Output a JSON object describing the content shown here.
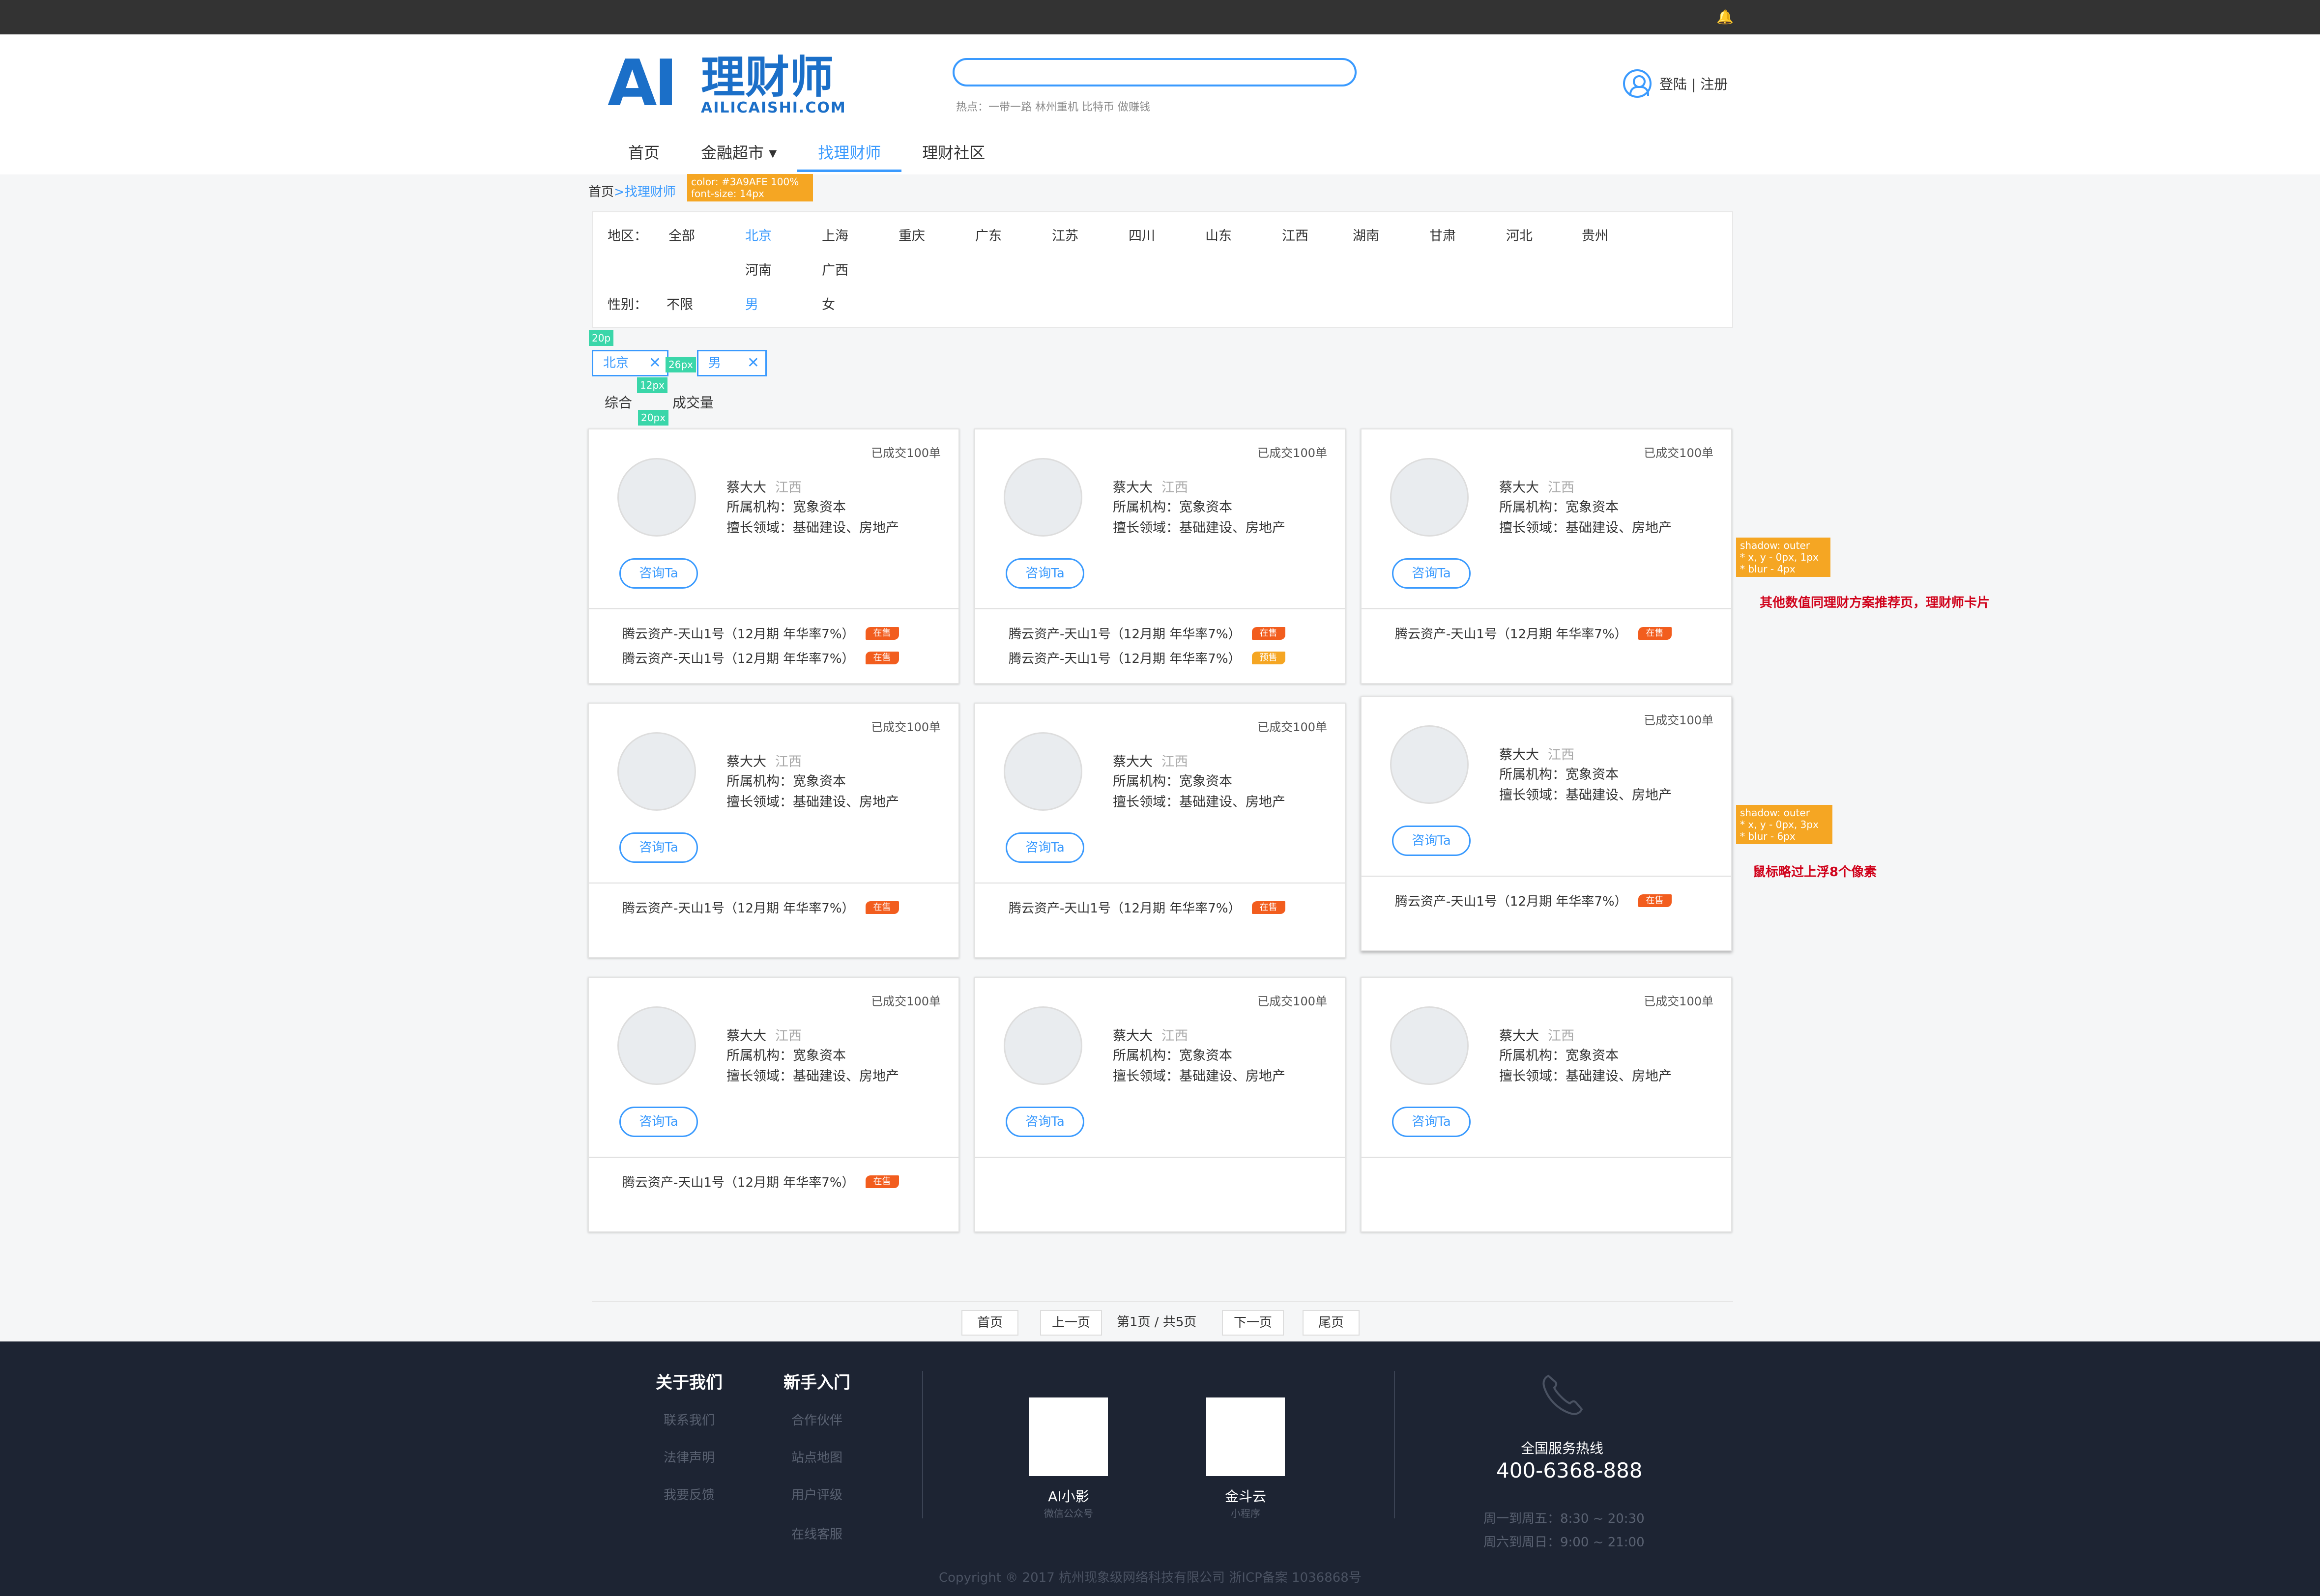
{
  "header": {
    "logo_mark": "AI",
    "logo_cn": "理财师",
    "logo_en": "AILICAISHI.COM",
    "search_value": "",
    "hot_text": "热点：一带一路 林州重机 比特币 做赚钱",
    "user_link": "登陆 | 注册"
  },
  "nav": [
    {
      "label": "首页"
    },
    {
      "label": "金融超市 ▾"
    },
    {
      "label": "找理财师"
    },
    {
      "label": "理财社区"
    }
  ],
  "breadcrumb": {
    "home": "首页",
    "sep": ">",
    "current": "找理财师"
  },
  "annotations": {
    "crumb_note_1": "color: #3A9AFE 100%",
    "crumb_note_2": "font-size: 14px",
    "gap_20": "20p",
    "gap_26": "26px",
    "gap_12": "12px",
    "gap_20b": "20px",
    "shadow1_a": "shadow: outer",
    "shadow1_b": "* x, y - 0px, 1px",
    "shadow1_c": "* blur - 4px",
    "shadow2_a": "shadow: outer",
    "shadow2_b": "* x, y - 0px, 3px",
    "shadow2_c": "* blur - 6px",
    "red_note_1": "其他数值同理财方案推荐页，理财师卡片",
    "red_note_2": "鼠标略过上浮8个像素"
  },
  "filter": {
    "region_label": "地区：",
    "regions": [
      "全部",
      "北京",
      "上海",
      "重庆",
      "广东",
      "江苏",
      "四川",
      "山东",
      "江西",
      "湖南",
      "甘肃",
      "河北",
      "贵州",
      "河南",
      "广西"
    ],
    "gender_label": "性别：",
    "genders": [
      "不限",
      "男",
      "女"
    ]
  },
  "selected_tags": [
    "北京",
    "男"
  ],
  "sort": {
    "comprehensive": "综合",
    "volume": "成交量"
  },
  "card": {
    "done": "已成交100单",
    "name": "蔡大大",
    "province": "江西",
    "org": "所属机构：宽象资本",
    "field": "擅长领域：基础建设、房地产",
    "button": "咨询Ta",
    "product": "腾云资产-天山1号（12月期 年华率7%）",
    "on_sale": "在售",
    "pre_sale": "预售"
  },
  "pagination": {
    "first": "首页",
    "prev": "上一页",
    "info": "第1页 / 共5页",
    "next": "下一页",
    "last": "尾页"
  },
  "footer": {
    "col1_title": "关于我们",
    "col1_links": [
      "联系我们",
      "法律声明",
      "我要反馈"
    ],
    "col2_title": "新手入门",
    "col2_links": [
      "合作伙伴",
      "站点地图",
      "用户评级",
      "在线客服"
    ],
    "qr1_label": "AI小影",
    "qr1_sub": "微信公众号",
    "qr2_label": "金斗云",
    "qr2_sub": "小程序",
    "hotline_label": "全国服务热线",
    "hotline": "400-6368-888",
    "hours1": "周一到周五：8:30 ~ 20:30",
    "hours2": "周六到周日：9:00 ~ 21:00",
    "copyright": "Copyright ® 2017 杭州现象级网络科技有限公司 浙ICP备案 1036868号"
  },
  "colors": {
    "accent": "#3A9AFE",
    "on_sale": "#F25D1E",
    "pre_sale": "#F5A623",
    "footer_bg": "#1D2433"
  }
}
